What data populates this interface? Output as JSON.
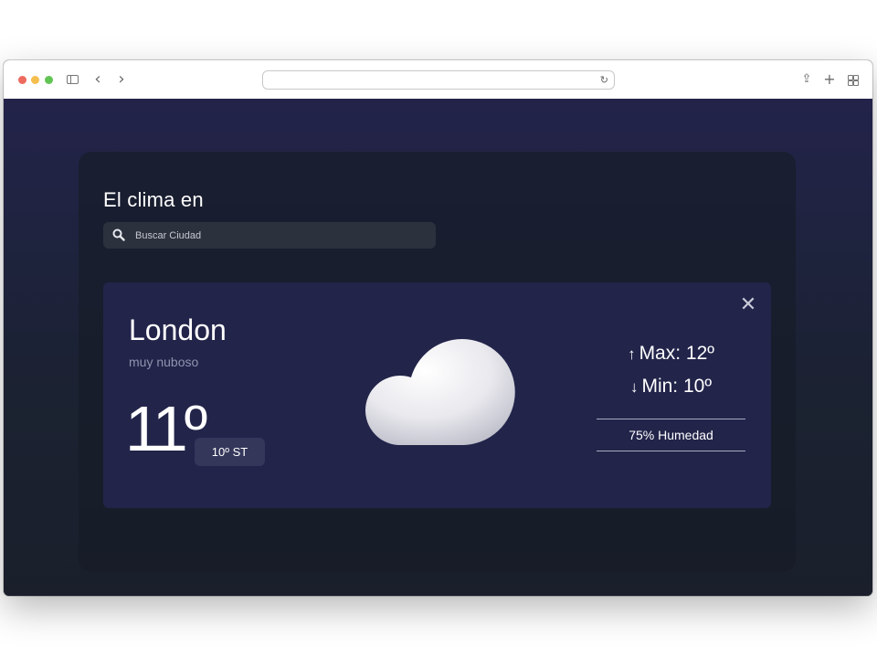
{
  "browser": {
    "icons": [
      "sidebar-icon",
      "back-icon",
      "forward-icon",
      "reload-icon",
      "share-icon",
      "plus-icon",
      "tabs-overview-icon"
    ],
    "url": ""
  },
  "app": {
    "heading": "El clima en",
    "search": {
      "placeholder": "Buscar Ciudad",
      "value": ""
    }
  },
  "weather": {
    "city": "London",
    "description": "muy nuboso",
    "temperature": "11º",
    "feels_like": "10º ST",
    "max_label": "Max: 12º",
    "min_label": "Min: 10º",
    "humidity": "75% Humedad",
    "icon": "cloud-icon"
  },
  "colors": {
    "card": "#22244a",
    "panel": "#161c26",
    "background": "#1a1f2b"
  }
}
